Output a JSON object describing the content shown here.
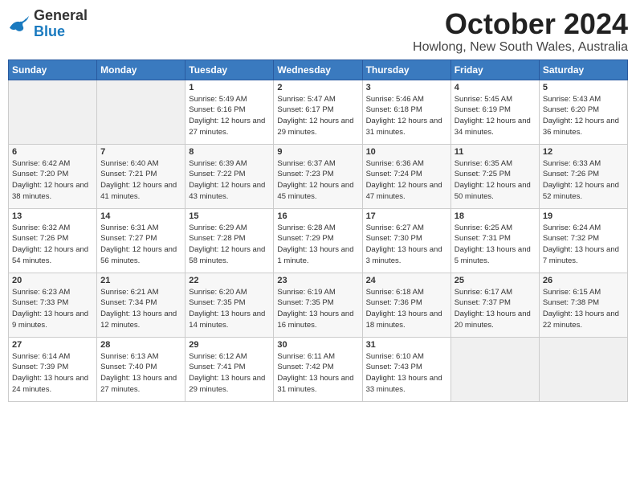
{
  "header": {
    "logo": {
      "line1": "General",
      "line2": "Blue"
    },
    "title": "October 2024",
    "location": "Howlong, New South Wales, Australia"
  },
  "days_of_week": [
    "Sunday",
    "Monday",
    "Tuesday",
    "Wednesday",
    "Thursday",
    "Friday",
    "Saturday"
  ],
  "weeks": [
    [
      {
        "day": "",
        "empty": true
      },
      {
        "day": "",
        "empty": true
      },
      {
        "day": "1",
        "sunrise": "5:49 AM",
        "sunset": "6:16 PM",
        "daylight": "12 hours and 27 minutes."
      },
      {
        "day": "2",
        "sunrise": "5:47 AM",
        "sunset": "6:17 PM",
        "daylight": "12 hours and 29 minutes."
      },
      {
        "day": "3",
        "sunrise": "5:46 AM",
        "sunset": "6:18 PM",
        "daylight": "12 hours and 31 minutes."
      },
      {
        "day": "4",
        "sunrise": "5:45 AM",
        "sunset": "6:19 PM",
        "daylight": "12 hours and 34 minutes."
      },
      {
        "day": "5",
        "sunrise": "5:43 AM",
        "sunset": "6:20 PM",
        "daylight": "12 hours and 36 minutes."
      }
    ],
    [
      {
        "day": "6",
        "sunrise": "6:42 AM",
        "sunset": "7:20 PM",
        "daylight": "12 hours and 38 minutes."
      },
      {
        "day": "7",
        "sunrise": "6:40 AM",
        "sunset": "7:21 PM",
        "daylight": "12 hours and 41 minutes."
      },
      {
        "day": "8",
        "sunrise": "6:39 AM",
        "sunset": "7:22 PM",
        "daylight": "12 hours and 43 minutes."
      },
      {
        "day": "9",
        "sunrise": "6:37 AM",
        "sunset": "7:23 PM",
        "daylight": "12 hours and 45 minutes."
      },
      {
        "day": "10",
        "sunrise": "6:36 AM",
        "sunset": "7:24 PM",
        "daylight": "12 hours and 47 minutes."
      },
      {
        "day": "11",
        "sunrise": "6:35 AM",
        "sunset": "7:25 PM",
        "daylight": "12 hours and 50 minutes."
      },
      {
        "day": "12",
        "sunrise": "6:33 AM",
        "sunset": "7:26 PM",
        "daylight": "12 hours and 52 minutes."
      }
    ],
    [
      {
        "day": "13",
        "sunrise": "6:32 AM",
        "sunset": "7:26 PM",
        "daylight": "12 hours and 54 minutes."
      },
      {
        "day": "14",
        "sunrise": "6:31 AM",
        "sunset": "7:27 PM",
        "daylight": "12 hours and 56 minutes."
      },
      {
        "day": "15",
        "sunrise": "6:29 AM",
        "sunset": "7:28 PM",
        "daylight": "12 hours and 58 minutes."
      },
      {
        "day": "16",
        "sunrise": "6:28 AM",
        "sunset": "7:29 PM",
        "daylight": "13 hours and 1 minute."
      },
      {
        "day": "17",
        "sunrise": "6:27 AM",
        "sunset": "7:30 PM",
        "daylight": "13 hours and 3 minutes."
      },
      {
        "day": "18",
        "sunrise": "6:25 AM",
        "sunset": "7:31 PM",
        "daylight": "13 hours and 5 minutes."
      },
      {
        "day": "19",
        "sunrise": "6:24 AM",
        "sunset": "7:32 PM",
        "daylight": "13 hours and 7 minutes."
      }
    ],
    [
      {
        "day": "20",
        "sunrise": "6:23 AM",
        "sunset": "7:33 PM",
        "daylight": "13 hours and 9 minutes."
      },
      {
        "day": "21",
        "sunrise": "6:21 AM",
        "sunset": "7:34 PM",
        "daylight": "13 hours and 12 minutes."
      },
      {
        "day": "22",
        "sunrise": "6:20 AM",
        "sunset": "7:35 PM",
        "daylight": "13 hours and 14 minutes."
      },
      {
        "day": "23",
        "sunrise": "6:19 AM",
        "sunset": "7:35 PM",
        "daylight": "13 hours and 16 minutes."
      },
      {
        "day": "24",
        "sunrise": "6:18 AM",
        "sunset": "7:36 PM",
        "daylight": "13 hours and 18 minutes."
      },
      {
        "day": "25",
        "sunrise": "6:17 AM",
        "sunset": "7:37 PM",
        "daylight": "13 hours and 20 minutes."
      },
      {
        "day": "26",
        "sunrise": "6:15 AM",
        "sunset": "7:38 PM",
        "daylight": "13 hours and 22 minutes."
      }
    ],
    [
      {
        "day": "27",
        "sunrise": "6:14 AM",
        "sunset": "7:39 PM",
        "daylight": "13 hours and 24 minutes."
      },
      {
        "day": "28",
        "sunrise": "6:13 AM",
        "sunset": "7:40 PM",
        "daylight": "13 hours and 27 minutes."
      },
      {
        "day": "29",
        "sunrise": "6:12 AM",
        "sunset": "7:41 PM",
        "daylight": "13 hours and 29 minutes."
      },
      {
        "day": "30",
        "sunrise": "6:11 AM",
        "sunset": "7:42 PM",
        "daylight": "13 hours and 31 minutes."
      },
      {
        "day": "31",
        "sunrise": "6:10 AM",
        "sunset": "7:43 PM",
        "daylight": "13 hours and 33 minutes."
      },
      {
        "day": "",
        "empty": true
      },
      {
        "day": "",
        "empty": true
      }
    ]
  ]
}
